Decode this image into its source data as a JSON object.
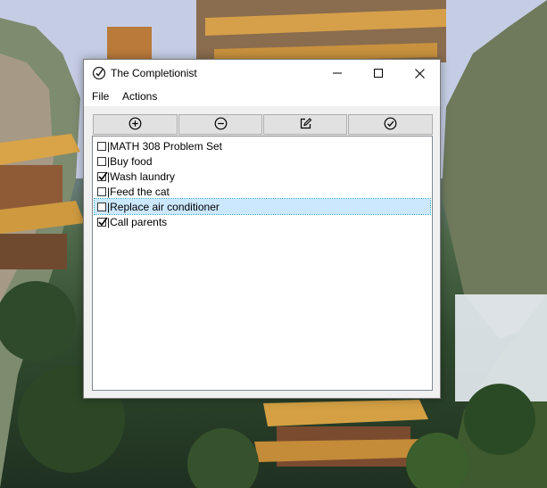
{
  "window": {
    "title": "The Completionist",
    "controls": {
      "minimize_icon": "minimize-icon",
      "maximize_icon": "maximize-icon",
      "close_icon": "close-icon"
    }
  },
  "menu": {
    "items": [
      {
        "label": "File"
      },
      {
        "label": "Actions"
      }
    ]
  },
  "toolbar": {
    "buttons": [
      {
        "icon": "plus-circle-icon"
      },
      {
        "icon": "minus-circle-icon"
      },
      {
        "icon": "edit-icon"
      },
      {
        "icon": "check-circle-icon"
      }
    ]
  },
  "tasks": [
    {
      "text": "MATH 308 Problem Set",
      "completed": false,
      "separator": "|"
    },
    {
      "text": "Buy food",
      "completed": false,
      "separator": "|"
    },
    {
      "text": "Wash laundry",
      "completed": true,
      "separator": "|"
    },
    {
      "text": "Feed the cat",
      "completed": false,
      "separator": "|"
    },
    {
      "text": "Replace air conditioner",
      "completed": false,
      "separator": "|",
      "selected": true
    },
    {
      "text": "Call parents",
      "completed": true,
      "separator": "|"
    }
  ],
  "colors": {
    "selection_bg": "#cce8ff",
    "selection_border": "#26a0da",
    "button_bg": "#e1e1e1",
    "window_bg": "#f0f0f0"
  }
}
